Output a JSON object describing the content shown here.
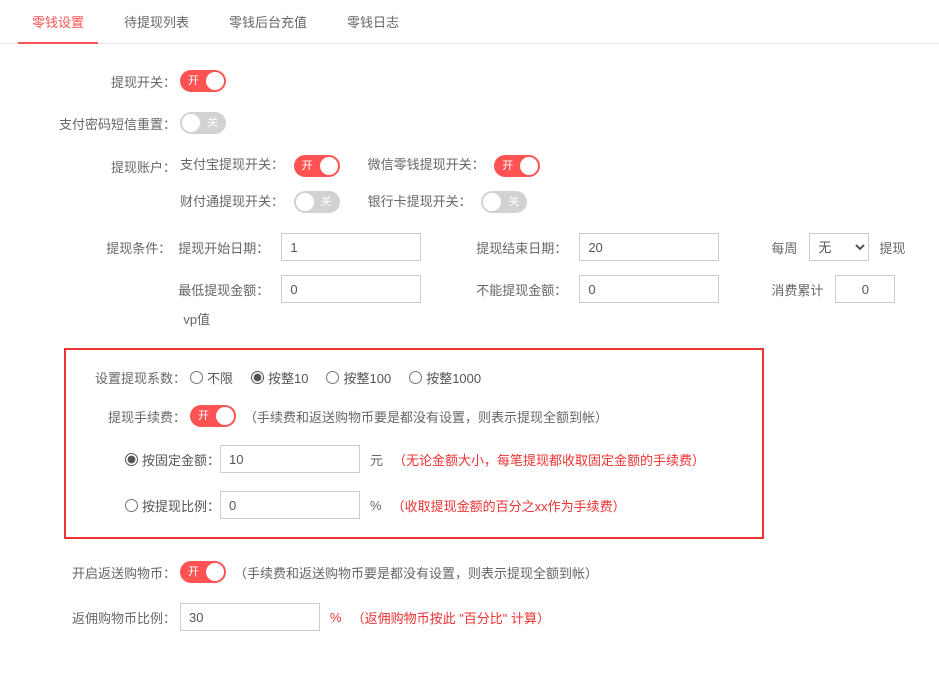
{
  "tabs": {
    "t0": "零钱设置",
    "t1": "待提现列表",
    "t2": "零钱后台充值",
    "t3": "零钱日志"
  },
  "labels": {
    "withdrawSwitch": "提现开关：",
    "paypwdSmsReset": "支付密码短信重置：",
    "withdrawAccount": "提现账户：",
    "withdrawCond": "提现条件：",
    "setCoeff": "设置提现系数：",
    "withdrawFee": "提现手续费：",
    "returnShopCoin": "开启返送购物币：",
    "rebateRatio": "返佣购物币比例："
  },
  "toggle": {
    "on": "开",
    "off": "关"
  },
  "accounts": {
    "alipay": "支付宝提现开关：",
    "wxWallet": "微信零钱提现开关：",
    "tenpay": "财付通提现开关：",
    "bankcard": "银行卡提现开关："
  },
  "cond": {
    "startDate": "提现开始日期：",
    "startDateVal": "1",
    "endDate": "提现结束日期：",
    "endDateVal": "20",
    "weekly": "每周",
    "weeklyVal": "无",
    "weeklySuffix": "提现",
    "minAmount": "最低提现金额：",
    "minAmountVal": "0",
    "notWithdraw": "不能提现金额：",
    "notWithdrawVal": "0",
    "consumeSum": "消费累计",
    "consumeSumVal": "0",
    "vp": "vp值"
  },
  "coeff": {
    "r0": "不限",
    "r1": "按整10",
    "r2": "按整100",
    "r3": "按整1000"
  },
  "fee": {
    "note": "（手续费和返送购物币要是都没有设置，则表示提现全额到帐）",
    "byFixed": "按固定金额：",
    "byFixedVal": "10",
    "byFixedUnit": "元",
    "byFixedNote": "（无论金额大小，每笔提现都收取固定金额的手续费）",
    "byRatio": "按提现比例：",
    "byRatioVal": "0",
    "byRatioUnit": "%",
    "byRatioNote": "（收取提现金额的百分之xx作为手续费）"
  },
  "returnCoin": {
    "note": "（手续费和返送购物币要是都没有设置，则表示提现全额到帐）"
  },
  "rebate": {
    "val": "30",
    "unit": "%",
    "note": "（返佣购物币按此 \"百分比\" 计算）"
  }
}
